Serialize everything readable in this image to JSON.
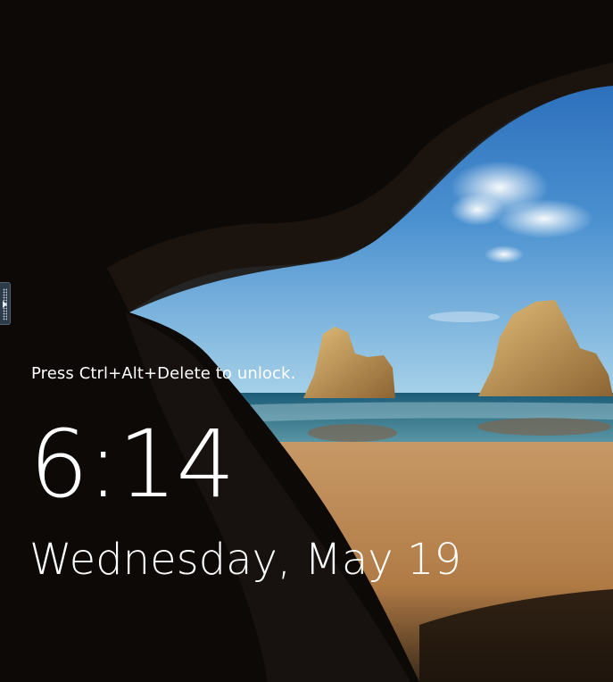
{
  "lock_screen": {
    "unlock_hint": "Press Ctrl+Alt+Delete to unlock.",
    "time": "6:14",
    "date": "Wednesday, May 19"
  },
  "side_handle": {
    "icon": "chevron-right-icon"
  },
  "colors": {
    "sky_top": "#1f63b8",
    "sky_bottom": "#8cc3e0",
    "sea": "#2f6f86",
    "sand": "#b9854f",
    "rock": "#c59a58",
    "cave": "#120d0a"
  }
}
